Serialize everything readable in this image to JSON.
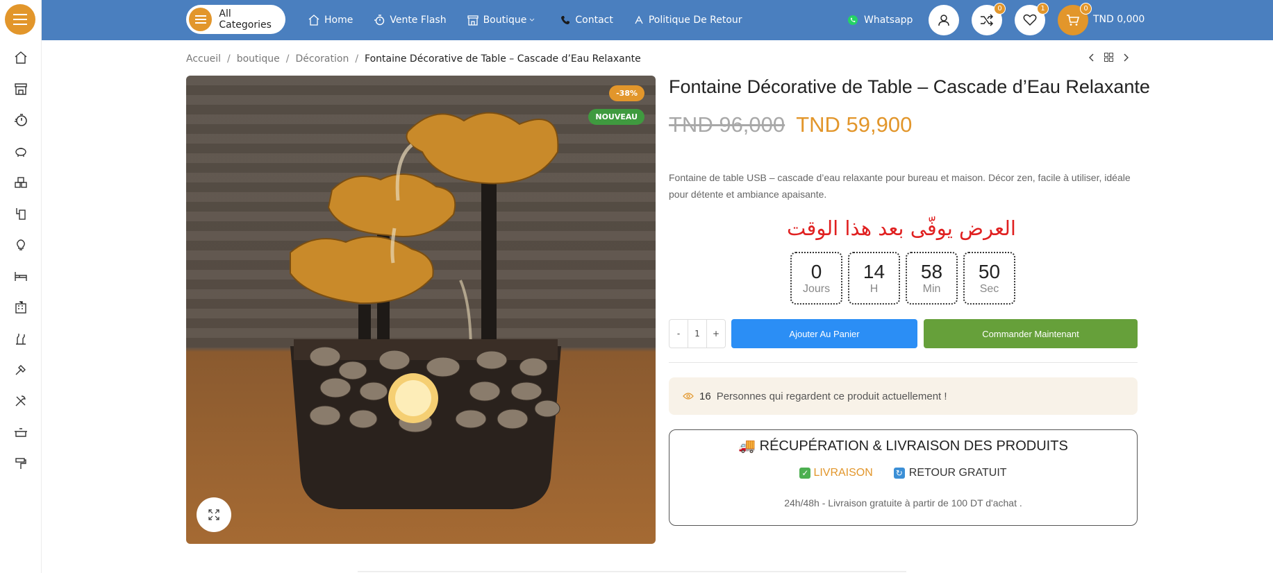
{
  "header": {
    "all_categories": "All Categories",
    "nav": [
      {
        "label": "Home",
        "icon": "home-icon"
      },
      {
        "label": "Vente Flash",
        "icon": "flash-timer-icon"
      },
      {
        "label": "Boutique",
        "icon": "shop-icon",
        "dropdown": true
      },
      {
        "label": "Contact",
        "icon": "phone-icon"
      },
      {
        "label": "Politique De Retour",
        "icon": "return-icon"
      }
    ],
    "whatsapp": "Whatsapp",
    "compare_count": "0",
    "wishlist_count": "1",
    "cart_count": "0",
    "cart_total": "TND 0,000",
    "accent_color": "#e2962b",
    "bar_color": "#4a7fbf"
  },
  "breadcrumb": {
    "items": [
      "Accueil",
      "boutique",
      "Décoration"
    ],
    "current": "Fontaine Décorative de Table – Cascade d’Eau Relaxante"
  },
  "product": {
    "title": "Fontaine Décorative de Table – Cascade d’Eau Relaxante",
    "old_price": "TND 96,000",
    "new_price": "TND 59,900",
    "description": "Fontaine de table USB – cascade d’eau relaxante pour bureau et maison. Décor zen, facile à utiliser, idéale pour détente et ambiance apaisante.",
    "sale_badge": "-38%",
    "new_badge": "NOUVEAU"
  },
  "offer": {
    "title": "العرض يوفّى بعد هذا الوقت",
    "countdown": [
      {
        "value": "0",
        "label": "Jours"
      },
      {
        "value": "14",
        "label": "H"
      },
      {
        "value": "58",
        "label": "Min"
      },
      {
        "value": "50",
        "label": "Sec"
      }
    ]
  },
  "purchase": {
    "qty_minus": "-",
    "qty_value": "1",
    "qty_plus": "+",
    "add_to_cart": "Ajouter Au Panier",
    "order_now": "Commander Maintenant"
  },
  "viewers": {
    "count": "16",
    "text": "Personnes qui regardent ce produit actuellement !"
  },
  "delivery": {
    "title": "🚚 RÉCUPÉRATION & LIVRAISON DES PRODUITS",
    "option_a": "LIVRAISON",
    "option_b": "RETOUR GRATUIT",
    "note": "24h/48h - Livraison gratuite à partir de 100 DT d'achat ."
  },
  "sidebar_icons": [
    "home-icon",
    "store-icon",
    "flash-timer-icon",
    "piggy-bank-icon",
    "boxes-icon",
    "phone-charger-icon",
    "lightbulb-icon",
    "bed-icon",
    "building-icon",
    "bottles-icon",
    "flashlight-icon",
    "tools-icon",
    "kitchen-pot-icon",
    "paint-roller-icon"
  ]
}
